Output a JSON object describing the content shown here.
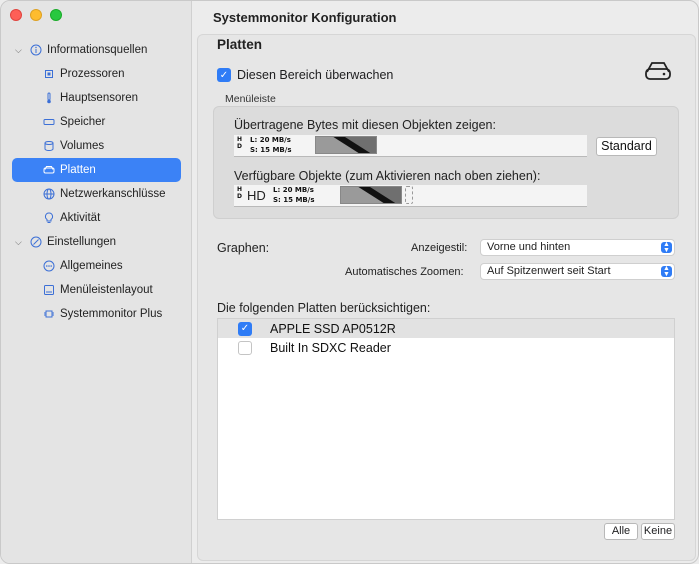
{
  "window": {
    "title": "Systemmonitor Konfiguration"
  },
  "sidebar": {
    "groups": [
      {
        "label": "Informationsquellen",
        "icon": "info-circle-icon",
        "items": [
          {
            "label": "Prozessoren",
            "icon": "cpu-icon"
          },
          {
            "label": "Hauptsensoren",
            "icon": "thermometer-icon"
          },
          {
            "label": "Speicher",
            "icon": "memory-icon"
          },
          {
            "label": "Volumes",
            "icon": "database-icon"
          },
          {
            "label": "Platten",
            "icon": "hard-drive-icon",
            "selected": true
          },
          {
            "label": "Netzwerkanschlüsse",
            "icon": "globe-icon"
          },
          {
            "label": "Aktivität",
            "icon": "lightbulb-icon"
          }
        ]
      },
      {
        "label": "Einstellungen",
        "icon": "slash-circle-icon",
        "items": [
          {
            "label": "Allgemeines",
            "icon": "ellipsis-circle-icon"
          },
          {
            "label": "Menüleistenlayout",
            "icon": "menubar-icon"
          },
          {
            "label": "Systemmonitor Plus",
            "icon": "chip-icon"
          }
        ]
      }
    ]
  },
  "section": {
    "title": "Platten",
    "watch_label": "Diesen Bereich überwachen",
    "watch_checked": true
  },
  "menubar": {
    "label": "Menüleiste",
    "shown_label": "Übertragene Bytes mit diesen Objekten zeigen:",
    "available_label": "Verfügbare Objekte (zum Aktivieren nach oben ziehen):",
    "default_button": "Standard",
    "hd_letters": "H D",
    "hd_big": "HD",
    "read_rate": "L: 20 MB/s",
    "write_rate": "S: 15 MB/s"
  },
  "graphs": {
    "label": "Graphen:",
    "style_label": "Anzeigestil:",
    "style_value": "Vorne und hinten",
    "zoom_label": "Automatisches Zoomen:",
    "zoom_value": "Auf Spitzenwert seit Start"
  },
  "disks": {
    "label": "Die folgenden Platten berücksichtigen:",
    "items": [
      {
        "name": "APPLE SSD AP0512R",
        "checked": true
      },
      {
        "name": "Built In SDXC Reader",
        "checked": false
      }
    ],
    "all_button": "Alle",
    "none_button": "Keine"
  }
}
